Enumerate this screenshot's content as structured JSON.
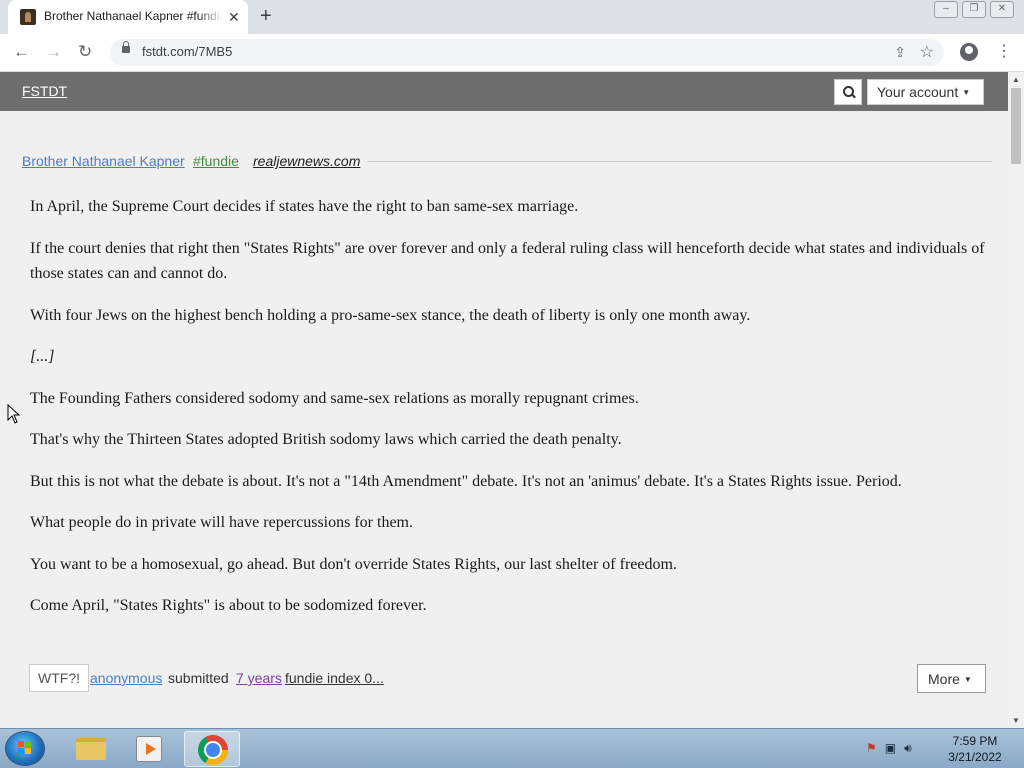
{
  "browser": {
    "tab_title": "Brother Nathanael Kapner #fundie",
    "tab_close": "✕",
    "new_tab": "+",
    "window_buttons": [
      "‒",
      "❐",
      "✕"
    ],
    "url": "fstdt.com/7MB5",
    "nav": {
      "back": "←",
      "forward": "→",
      "reload": "↻"
    },
    "icons": {
      "share": "⇪",
      "star": "☆",
      "menu": "⋮"
    }
  },
  "site": {
    "logo": "FSTDT",
    "account_button": "Your account",
    "caret": "▼"
  },
  "quote": {
    "author": "Brother Nathanael Kapner",
    "tag": "#fundie",
    "source": "realjewnews.com",
    "paragraphs": [
      "In April, the Supreme Court decides if states have the right to ban same-sex marriage.",
      "If the court denies that right then \"States Rights\" are over forever and only a federal ruling class will henceforth decide what states and individuals of those states can and cannot do.",
      "With four Jews on the highest bench holding a pro-same-sex stance, the death of liberty is only one month away.",
      "[...]",
      "The Founding Fathers considered sodomy and same-sex relations as morally repugnant crimes.",
      "That's why the Thirteen States adopted British sodomy laws which carried the death penalty.",
      "But this is not what the debate is about. It's not a \"14th Amendment\" debate. It's not an 'animus' debate. It's a States Rights issue. Period.",
      "What people do in private will have repercussions for them.",
      "You want to be a homosexual, go ahead. But don't override States Rights, our last shelter of freedom.",
      "Come April, \"States Rights\" is about to be sodomized forever."
    ],
    "footer": {
      "wtf_button": "WTF?!",
      "submitter": "anonymous",
      "submitted_text": "submitted",
      "age": "7 years",
      "index_text": "fundie index 0...",
      "more_button": "More"
    }
  },
  "taskbar": {
    "time": "7:59 PM",
    "date": "3/21/2022",
    "tray_icons": [
      "flag-icon",
      "network-icon",
      "volume-icon"
    ]
  },
  "colors": {
    "site_header": "#6e6e6e",
    "page_background": "#f0f0f0",
    "author_link": "#4a7fc1",
    "tag_link": "#3f8f3f",
    "visited_link": "#7a3fa0"
  }
}
